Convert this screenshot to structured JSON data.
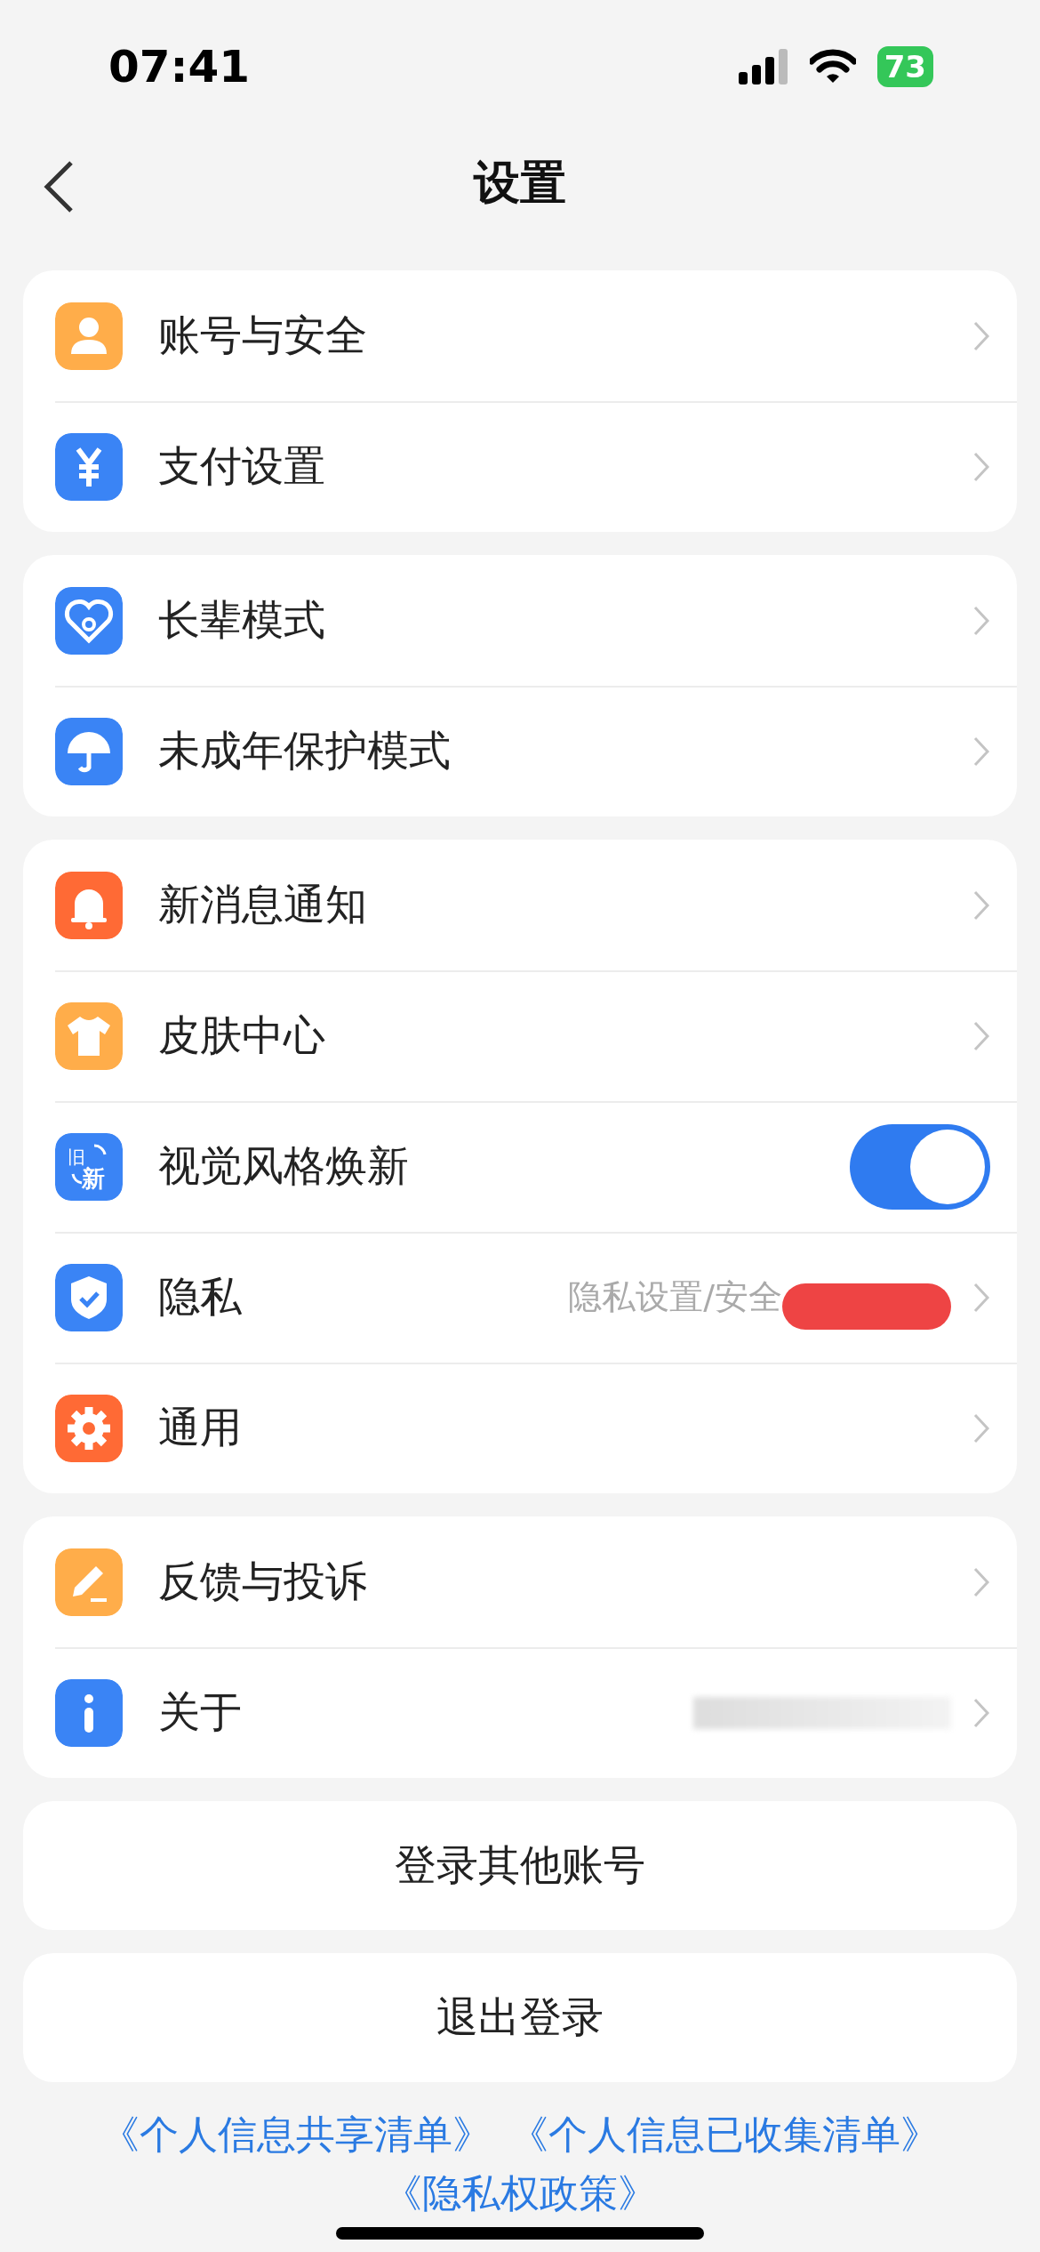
{
  "status_bar": {
    "time": "07:41",
    "battery": "73"
  },
  "header": {
    "title": "设置"
  },
  "groups": [
    {
      "items": [
        {
          "kind": "link",
          "label": "账号与安全"
        },
        {
          "kind": "link",
          "label": "支付设置"
        }
      ]
    },
    {
      "items": [
        {
          "kind": "link",
          "label": "长辈模式"
        },
        {
          "kind": "link",
          "label": "未成年保护模式"
        }
      ]
    },
    {
      "items": [
        {
          "kind": "link",
          "label": "新消息通知"
        },
        {
          "kind": "link",
          "label": "皮肤中心"
        },
        {
          "kind": "toggle",
          "icon_text": [
            "旧",
            "新"
          ],
          "label": "视觉风格焕新",
          "on": true
        },
        {
          "kind": "link",
          "label": "隐私",
          "value": "隐私设置/安全",
          "redacted": true
        },
        {
          "kind": "link",
          "label": "通用"
        }
      ]
    },
    {
      "items": [
        {
          "kind": "link",
          "label": "反馈与投诉"
        },
        {
          "kind": "link",
          "label": "关于",
          "blurred_value": true
        }
      ]
    }
  ],
  "buttons": [
    "登录其他账号",
    "退出登录"
  ],
  "links": [
    "《个人信息共享清单》",
    "《个人信息已收集清单》",
    "《隐私权政策》"
  ]
}
